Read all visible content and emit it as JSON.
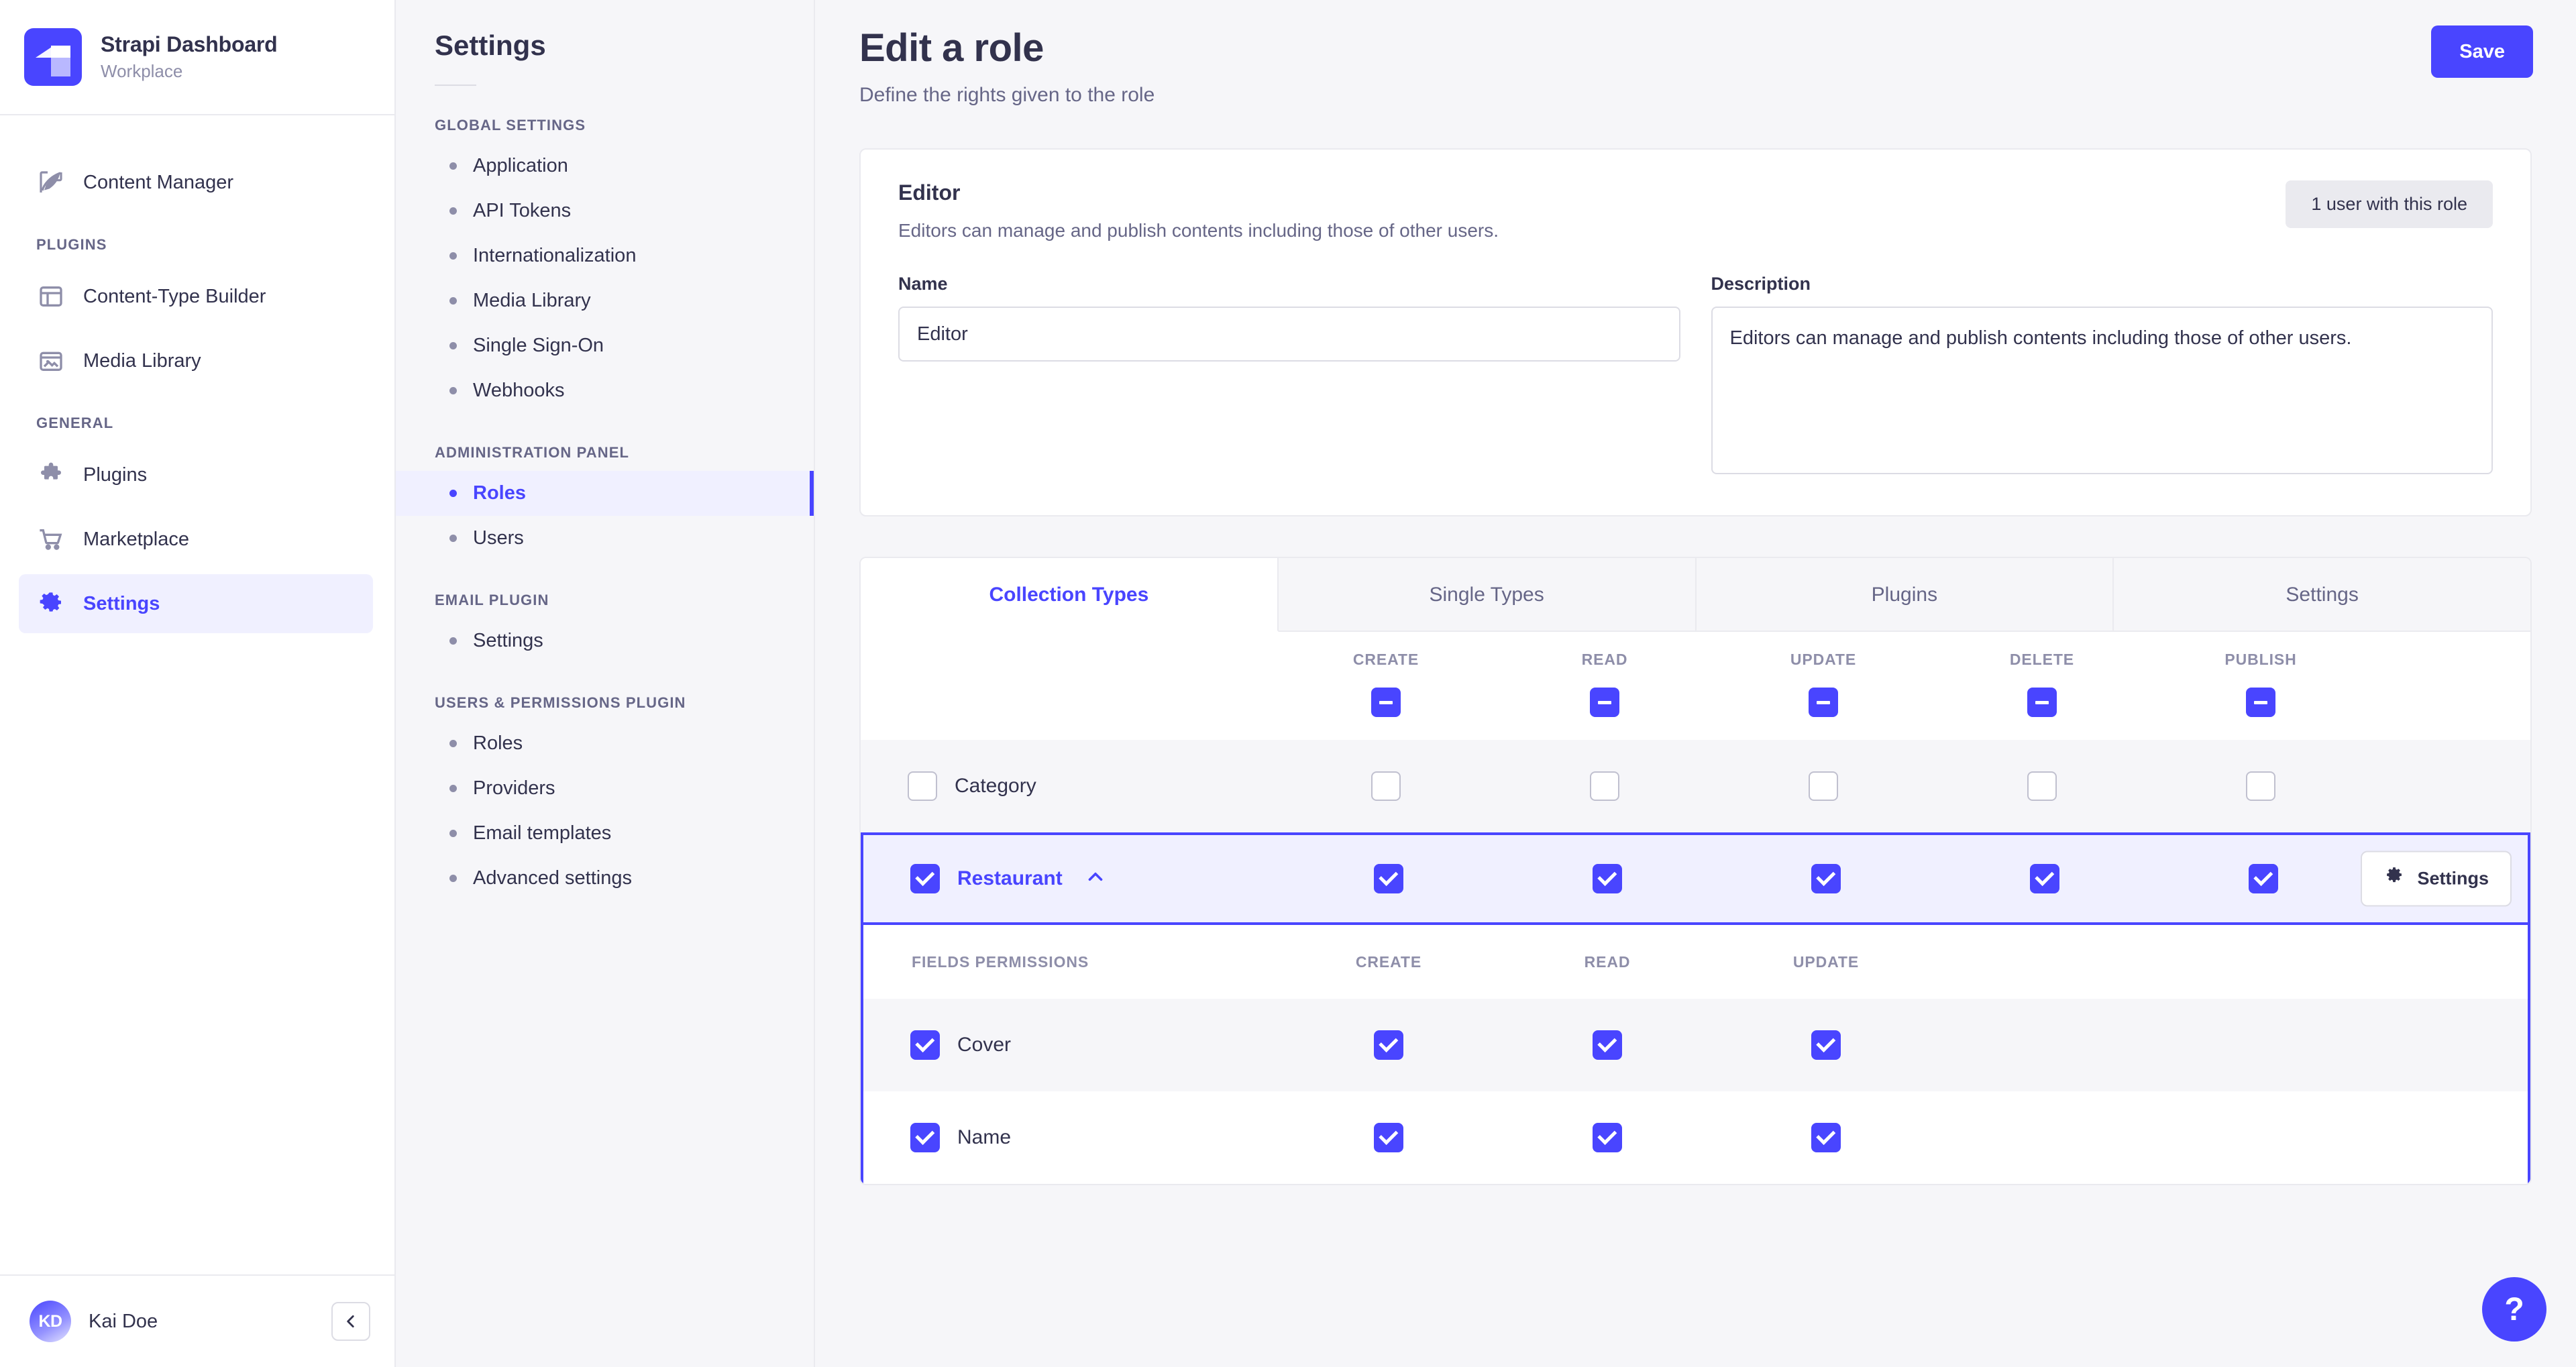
{
  "sidebar": {
    "brand": {
      "title": "Strapi Dashboard",
      "subtitle": "Workplace",
      "logo_color": "#4945ff"
    },
    "top_items": [
      {
        "label": "Content Manager",
        "icon": "feather-icon"
      }
    ],
    "sections": [
      {
        "label": "PLUGINS",
        "items": [
          {
            "label": "Content-Type Builder",
            "icon": "layout-icon"
          },
          {
            "label": "Media Library",
            "icon": "image-icon"
          }
        ]
      },
      {
        "label": "GENERAL",
        "items": [
          {
            "label": "Plugins",
            "icon": "puzzle-icon"
          },
          {
            "label": "Marketplace",
            "icon": "cart-icon"
          },
          {
            "label": "Settings",
            "icon": "gear-icon",
            "active": true
          }
        ]
      }
    ],
    "user": {
      "initials": "KD",
      "name": "Kai Doe"
    },
    "collapse_icon": "chevron-left-icon"
  },
  "settings_panel": {
    "title": "Settings",
    "sections": [
      {
        "label": "GLOBAL SETTINGS",
        "items": [
          {
            "label": "Application"
          },
          {
            "label": "API Tokens"
          },
          {
            "label": "Internationalization"
          },
          {
            "label": "Media Library"
          },
          {
            "label": "Single Sign-On"
          },
          {
            "label": "Webhooks"
          }
        ]
      },
      {
        "label": "ADMINISTRATION PANEL",
        "items": [
          {
            "label": "Roles",
            "active": true
          },
          {
            "label": "Users"
          }
        ]
      },
      {
        "label": "EMAIL PLUGIN",
        "items": [
          {
            "label": "Settings"
          }
        ]
      },
      {
        "label": "USERS & PERMISSIONS PLUGIN",
        "items": [
          {
            "label": "Roles"
          },
          {
            "label": "Providers"
          },
          {
            "label": "Email templates"
          },
          {
            "label": "Advanced settings"
          }
        ]
      }
    ]
  },
  "main": {
    "page_title": "Edit a role",
    "page_subtitle": "Define the rights given to the role",
    "save_label": "Save",
    "role_card": {
      "role_name": "Editor",
      "role_description": "Editors can manage and publish contents including those of other users.",
      "users_badge": "1 user with this role",
      "name_label": "Name",
      "name_value": "Editor",
      "name_placeholder": "Name",
      "description_label": "Description",
      "description_value": "Editors can manage and publish contents including those of other users.",
      "description_placeholder": "Description"
    },
    "tabs": [
      {
        "label": "Collection Types",
        "active": true
      },
      {
        "label": "Single Types",
        "active": false
      },
      {
        "label": "Plugins",
        "active": false
      },
      {
        "label": "Settings",
        "active": false
      }
    ],
    "permissions": {
      "columns": [
        "CREATE",
        "READ",
        "UPDATE",
        "DELETE",
        "PUBLISH"
      ],
      "header_states": [
        "indeterminate",
        "indeterminate",
        "indeterminate",
        "indeterminate",
        "indeterminate"
      ],
      "rows": [
        {
          "label": "Category",
          "row_checked": false,
          "values": [
            false,
            false,
            false,
            false,
            false
          ],
          "expanded": false,
          "shaded": true
        },
        {
          "label": "Restaurant",
          "row_checked": true,
          "values": [
            true,
            true,
            true,
            true,
            true
          ],
          "expanded": true,
          "expand_icon": "chevron-up-icon",
          "settings_label": "Settings",
          "settings_icon": "gear-icon"
        }
      ],
      "fields_section": {
        "label": "FIELDS PERMISSIONS",
        "columns": [
          "CREATE",
          "READ",
          "UPDATE"
        ],
        "fields": [
          {
            "label": "Cover",
            "checked": true,
            "values": [
              true,
              true,
              true
            ],
            "shaded": true
          },
          {
            "label": "Name",
            "checked": true,
            "values": [
              true,
              true,
              true
            ],
            "shaded": false
          }
        ]
      }
    },
    "help_label": "?"
  }
}
